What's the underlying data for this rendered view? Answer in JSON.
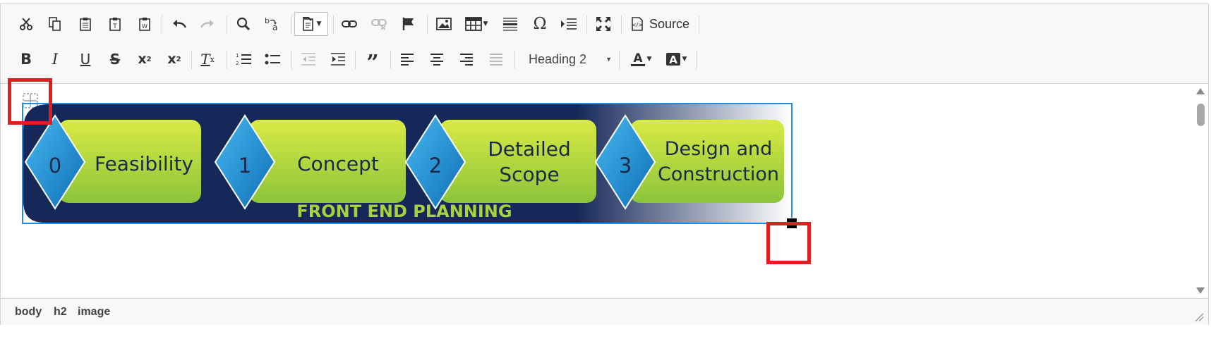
{
  "toolbar": {
    "source_label": "Source",
    "format_value": "Heading 2"
  },
  "image": {
    "steps": [
      {
        "number": "0",
        "label": "Feasibility"
      },
      {
        "number": "1",
        "label": "Concept"
      },
      {
        "number": "2",
        "label_line1": "Detailed",
        "label_line2": "Scope"
      },
      {
        "number": "3",
        "label_line1": "Design and",
        "label_line2": "Construction"
      }
    ],
    "banner_title": "FRONT END PLANNING"
  },
  "statusbar": {
    "path": [
      "body",
      "h2",
      "image"
    ]
  },
  "colors": {
    "selection": "#1f8ee3",
    "highlight": "#dd1f1f",
    "banner_bg": "#16285a",
    "step_green": "#b8dc32",
    "diamond_blue": "#1f94d8",
    "banner_title": "#a8d23a"
  }
}
